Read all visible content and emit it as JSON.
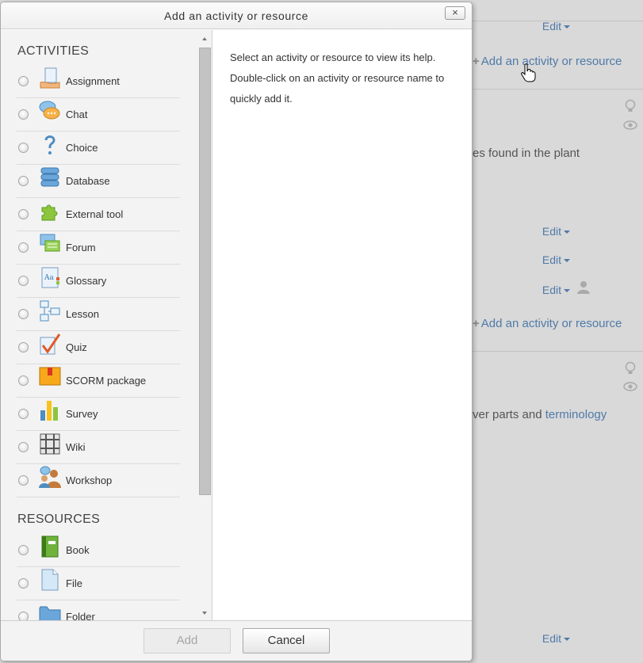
{
  "dialog": {
    "title": "Add an activity or resource",
    "close_label": "×",
    "help_text": "Select an activity or resource to view its help. Double-click on an activity or resource name to quickly add it.",
    "add_label": "Add",
    "cancel_label": "Cancel"
  },
  "activities": {
    "heading": "ACTIVITIES",
    "items": [
      {
        "label": "Assignment",
        "icon": "assignment-icon"
      },
      {
        "label": "Chat",
        "icon": "chat-icon"
      },
      {
        "label": "Choice",
        "icon": "choice-icon"
      },
      {
        "label": "Database",
        "icon": "database-icon"
      },
      {
        "label": "External tool",
        "icon": "external-tool-icon"
      },
      {
        "label": "Forum",
        "icon": "forum-icon"
      },
      {
        "label": "Glossary",
        "icon": "glossary-icon"
      },
      {
        "label": "Lesson",
        "icon": "lesson-icon"
      },
      {
        "label": "Quiz",
        "icon": "quiz-icon"
      },
      {
        "label": "SCORM package",
        "icon": "scorm-icon"
      },
      {
        "label": "Survey",
        "icon": "survey-icon"
      },
      {
        "label": "Wiki",
        "icon": "wiki-icon"
      },
      {
        "label": "Workshop",
        "icon": "workshop-icon"
      }
    ]
  },
  "resources": {
    "heading": "RESOURCES",
    "items": [
      {
        "label": "Book",
        "icon": "book-icon"
      },
      {
        "label": "File",
        "icon": "file-icon"
      },
      {
        "label": "Folder",
        "icon": "folder-icon"
      }
    ]
  },
  "background": {
    "edit_label": "Edit",
    "add_activity_label": "Add an activity or resource",
    "text1": "es found in the plant",
    "text2_prefix": "ver parts and ",
    "text2_link": "terminology"
  },
  "colors": {
    "link": "#4f7aa8",
    "overlay": "#d9d9d9"
  }
}
